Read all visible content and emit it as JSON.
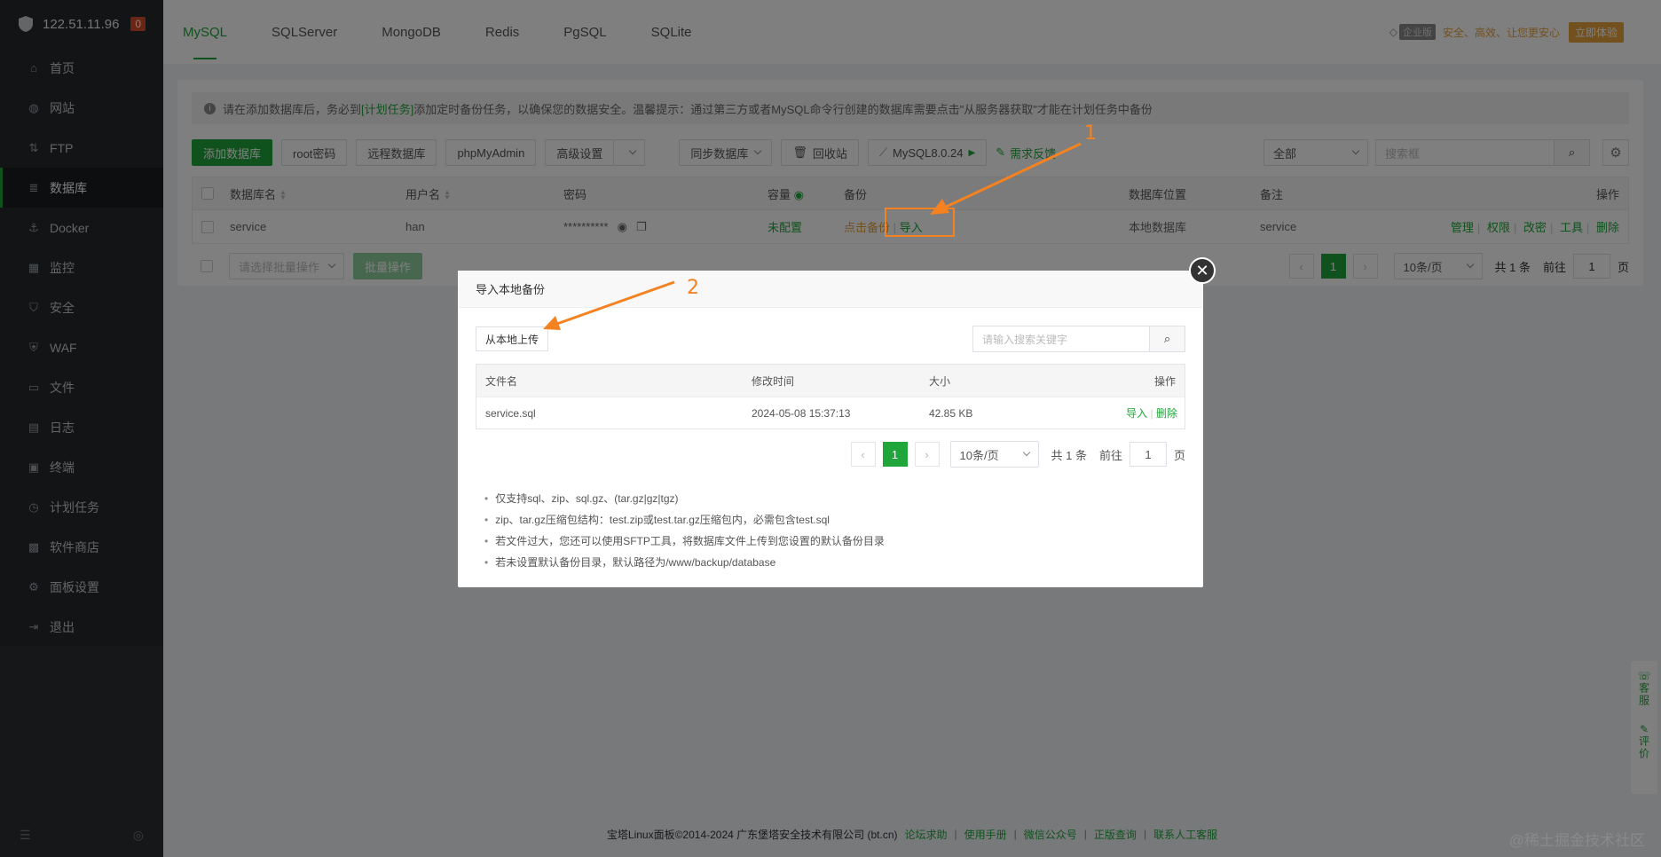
{
  "sidebar": {
    "ip": "122.51.11.96",
    "badge": "0",
    "items": [
      {
        "label": "首页",
        "icon": "home-icon"
      },
      {
        "label": "网站",
        "icon": "globe-icon"
      },
      {
        "label": "FTP",
        "icon": "ftp-icon"
      },
      {
        "label": "数据库",
        "icon": "database-icon"
      },
      {
        "label": "Docker",
        "icon": "docker-icon"
      },
      {
        "label": "监控",
        "icon": "monitor-icon"
      },
      {
        "label": "安全",
        "icon": "shield-icon"
      },
      {
        "label": "WAF",
        "icon": "waf-icon"
      },
      {
        "label": "文件",
        "icon": "folder-icon"
      },
      {
        "label": "日志",
        "icon": "log-icon"
      },
      {
        "label": "终端",
        "icon": "terminal-icon"
      },
      {
        "label": "计划任务",
        "icon": "clock-icon"
      },
      {
        "label": "软件商店",
        "icon": "store-icon"
      },
      {
        "label": "面板设置",
        "icon": "settings-icon"
      },
      {
        "label": "退出",
        "icon": "logout-icon"
      }
    ],
    "active_index": 3
  },
  "tabs": [
    "MySQL",
    "SQLServer",
    "MongoDB",
    "Redis",
    "PgSQL",
    "SQLite"
  ],
  "top_right": {
    "edition": "企业版",
    "slogan": "安全、高效、让您更安心",
    "try_button": "立即体验"
  },
  "notice": {
    "part1": "请在添加数据库后，务必到",
    "link": "[计划任务]",
    "part2": "添加定时备份任务，以确保您的数据安全。温馨提示：通过第三方或者MySQL命令行创建的数据库需要点击\"从服务器获取\"才能在计划任务中备份"
  },
  "toolbar": {
    "add_db": "添加数据库",
    "root_pwd": "root密码",
    "remote_db": "远程数据库",
    "phpmyadmin": "phpMyAdmin",
    "advanced": "高级设置",
    "sync_db": "同步数据库",
    "recycle": "回收站",
    "mysql_version": "MySQL8.0.24",
    "feedback": "需求反馈",
    "filter": "全部",
    "search_placeholder": "搜索框"
  },
  "table": {
    "headers": [
      "数据库名",
      "用户名",
      "密码",
      "容量",
      "备份",
      "数据库位置",
      "备注",
      "操作"
    ],
    "row": {
      "name": "service",
      "user": "han",
      "password": "**********",
      "capacity": "未配置",
      "backup": "点击备份",
      "import": "导入",
      "location": "本地数据库",
      "remark": "service",
      "actions": [
        "管理",
        "权限",
        "改密",
        "工具",
        "删除"
      ]
    }
  },
  "bulk": {
    "select_placeholder": "请选择批量操作",
    "button": "批量操作"
  },
  "pager": {
    "current": "1",
    "per_page": "10条/页",
    "total": "共 1 条",
    "goto": "前往",
    "page_input": "1",
    "page_unit": "页"
  },
  "modal": {
    "title": "导入本地备份",
    "upload_button": "从本地上传",
    "search_placeholder": "请输入搜索关键字",
    "headers": [
      "文件名",
      "修改时间",
      "大小",
      "操作"
    ],
    "row": {
      "file": "service.sql",
      "mtime": "2024-05-08 15:37:13",
      "size": "42.85 KB",
      "import": "导入",
      "delete": "删除"
    },
    "pager": {
      "current": "1",
      "per_page": "10条/页",
      "total": "共 1 条",
      "goto": "前往",
      "page_input": "1",
      "page_unit": "页"
    },
    "notes": [
      "仅支持sql、zip、sql.gz、(tar.gz|gz|tgz)",
      "zip、tar.gz压缩包结构：test.zip或test.tar.gz压缩包内，必需包含test.sql",
      "若文件过大，您还可以使用SFTP工具，将数据库文件上传到您设置的默认备份目录",
      "若未设置默认备份目录，默认路径为/www/backup/database"
    ]
  },
  "annotations": {
    "num1": "1",
    "num2": "2"
  },
  "float_widget": {
    "service": "客服",
    "review": "评价"
  },
  "footer": {
    "copyright": "宝塔Linux面板©2014-2024 广东堡塔安全技术有限公司 (bt.cn)",
    "links": [
      "论坛求助",
      "使用手册",
      "微信公众号",
      "正版查询",
      "联系人工客服"
    ]
  },
  "watermark": "@稀土掘金技术社区",
  "colors": {
    "accent": "#20a53a",
    "annotation": "#f58220",
    "sidebar": "#2b2e33"
  }
}
